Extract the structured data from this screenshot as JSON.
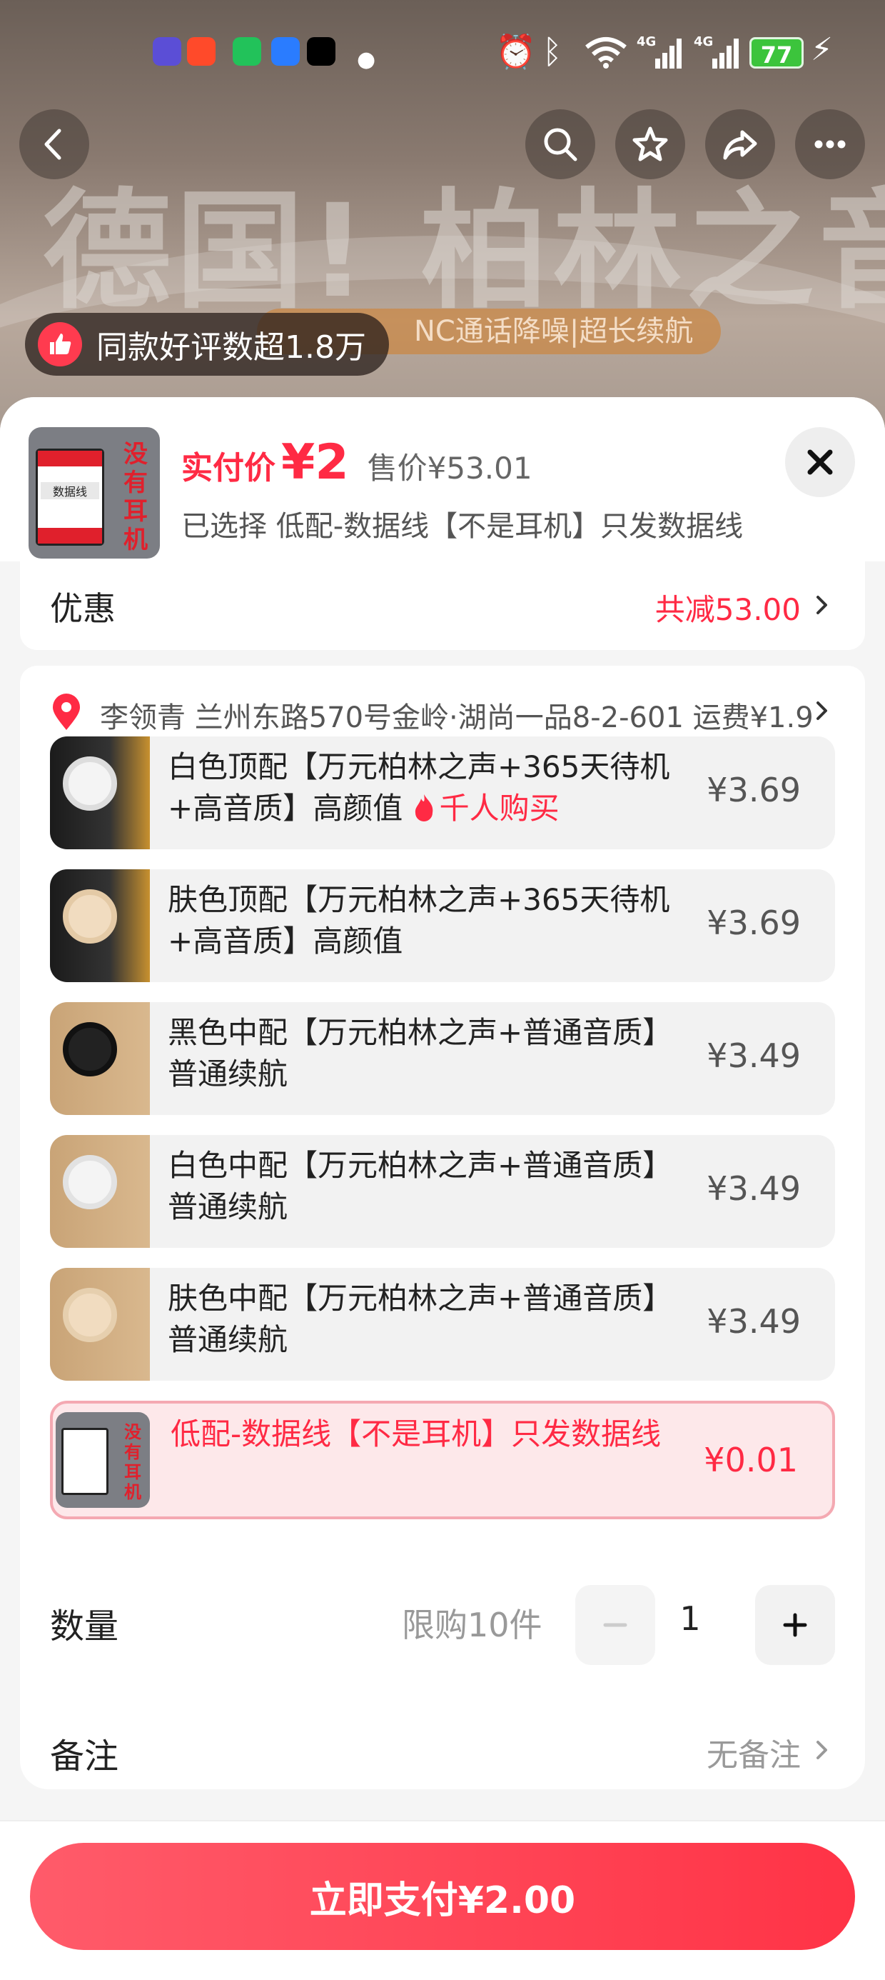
{
  "status_bar": {
    "battery": "77"
  },
  "hero": {
    "title": "德国! 柏林之音",
    "subtitle": "NC通话降噪|超长续航"
  },
  "review_badge": {
    "text": "同款好评数超1.8万"
  },
  "sheet": {
    "pay_label": "实付价",
    "pay_value": "¥2",
    "sale_price": "售价¥53.01",
    "selected": "已选择 低配-数据线【不是耳机】只发数据线",
    "thumb_text": "没有耳机",
    "thumb_label": "数据线"
  },
  "promo": {
    "label": "优惠",
    "value": "共减53.00"
  },
  "address": {
    "text": "李领青 兰州东路570号金岭·湖尚一品8-2-601 运费¥1.9"
  },
  "options": [
    {
      "title": "白色顶配【万元柏林之声+365天待机+高音质】高颜值",
      "hot": "千人购买",
      "price": "¥3.69",
      "selected": false
    },
    {
      "title": "肤色顶配【万元柏林之声+365天待机+高音质】高颜值",
      "price": "¥3.69",
      "selected": false
    },
    {
      "title": "黑色中配【万元柏林之声+普通音质】普通续航",
      "price": "¥3.49",
      "selected": false
    },
    {
      "title": "白色中配【万元柏林之声+普通音质】普通续航",
      "price": "¥3.49",
      "selected": false
    },
    {
      "title": "肤色中配【万元柏林之声+普通音质】普通续航",
      "price": "¥3.49",
      "selected": false
    },
    {
      "title": "低配-数据线【不是耳机】只发数据线",
      "price": "¥0.01",
      "selected": true
    }
  ],
  "quantity": {
    "label": "数量",
    "limit": "限购10件",
    "value": "1"
  },
  "note": {
    "label": "备注",
    "value": "无备注"
  },
  "footer": {
    "pay_button": "立即支付¥2.00"
  },
  "colors": {
    "accent": "#ff2a44",
    "selected_bg": "#fde8ea",
    "selected_border": "#f4a9b2"
  }
}
